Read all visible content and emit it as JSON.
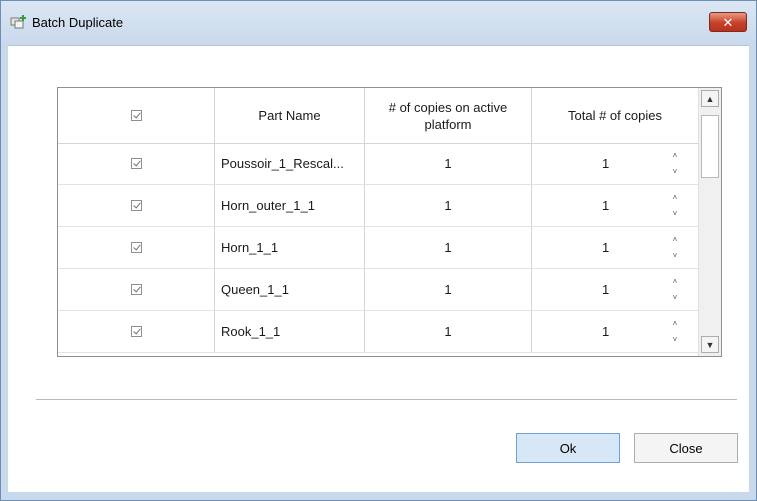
{
  "window": {
    "title": "Batch Duplicate",
    "title_icon": "batch-duplicate-icon",
    "close_glyph": "✕",
    "accent_close": "#c7402a"
  },
  "grid": {
    "headers": {
      "select": "",
      "part_name": "Part Name",
      "copies_active": "# of copies on active platform",
      "total_copies": "Total # of copies"
    },
    "header_checked": true,
    "rows": [
      {
        "checked": true,
        "part_name": "Poussoir_1_Rescal...",
        "copies_active": "1",
        "total_copies": "1"
      },
      {
        "checked": true,
        "part_name": "Horn_outer_1_1",
        "copies_active": "1",
        "total_copies": "1"
      },
      {
        "checked": true,
        "part_name": "Horn_1_1",
        "copies_active": "1",
        "total_copies": "1"
      },
      {
        "checked": true,
        "part_name": "Queen_1_1",
        "copies_active": "1",
        "total_copies": "1"
      },
      {
        "checked": true,
        "part_name": "Rook_1_1",
        "copies_active": "1",
        "total_copies": "1"
      }
    ],
    "spinner_up": "˄",
    "spinner_down": "˅",
    "scroll_up": "▲",
    "scroll_down": "▼"
  },
  "buttons": {
    "ok": "Ok",
    "close": "Close"
  }
}
